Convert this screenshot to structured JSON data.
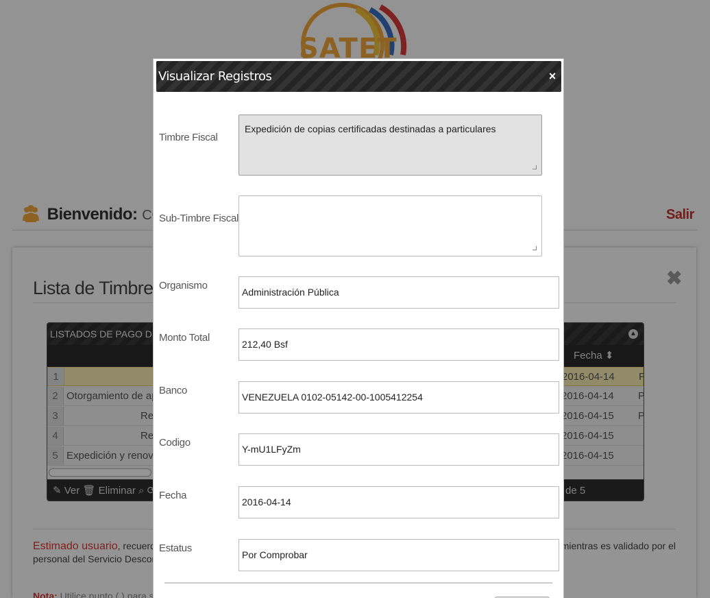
{
  "header": {
    "logo_text": "SATET",
    "welcome_label": "Bienvenido:",
    "welcome_user": "COMPIEI",
    "logout_label": "Salir"
  },
  "list_panel": {
    "title": "Lista de Timbres Fiscal",
    "grid_caption": "LISTADOS DE PAGO DE T",
    "fecha_header": "Fecha",
    "rows": [
      {
        "n": "1",
        "desc": "",
        "date": "2016-04-14",
        "status": "P"
      },
      {
        "n": "2",
        "desc": "Otorgamiento de apr",
        "date": "2016-04-14",
        "status": "P"
      },
      {
        "n": "3",
        "desc": "Re",
        "date": "2016-04-15",
        "status": "P"
      },
      {
        "n": "4",
        "desc": "Re",
        "date": "2016-04-15",
        "status": ""
      },
      {
        "n": "5",
        "desc": "Expedición y renovac",
        "date": "2016-04-15",
        "status": ""
      }
    ],
    "pager": {
      "ver_label": "Ver",
      "eliminar_label": "Eliminar",
      "page_info": "de 5"
    },
    "notice_highlight": "Estimado usuario",
    "notice_start": ", recuerde",
    "notice_line2": "personal del Servicio Desconc",
    "notice_right": "mientras es validado por el",
    "nota_label": "Nota:",
    "nota_text": " Utilice punto (.) para se"
  },
  "modal": {
    "title": "Visualizar Registros",
    "close_label": "×",
    "fields": {
      "timbre_fiscal": {
        "label": "Timbre Fiscal",
        "value": "Expedición de copias certificadas destinadas a particulares"
      },
      "sub_timbre_fiscal": {
        "label": "Sub-Timbre Fiscal",
        "value": ""
      },
      "organismo": {
        "label": "Organismo",
        "value": "Administración Pública"
      },
      "monto_total": {
        "label": "Monto Total",
        "value": "212,40 Bsf"
      },
      "banco": {
        "label": "Banco",
        "value": "VENEZUELA 0102-05142-00-1005412254"
      },
      "codigo": {
        "label": "Codigo",
        "value": "Y-mU1LFyZm"
      },
      "fecha": {
        "label": "Fecha",
        "value": "2016-04-14"
      },
      "estatus": {
        "label": "Estatus",
        "value": "Por Comprobar"
      }
    }
  }
}
